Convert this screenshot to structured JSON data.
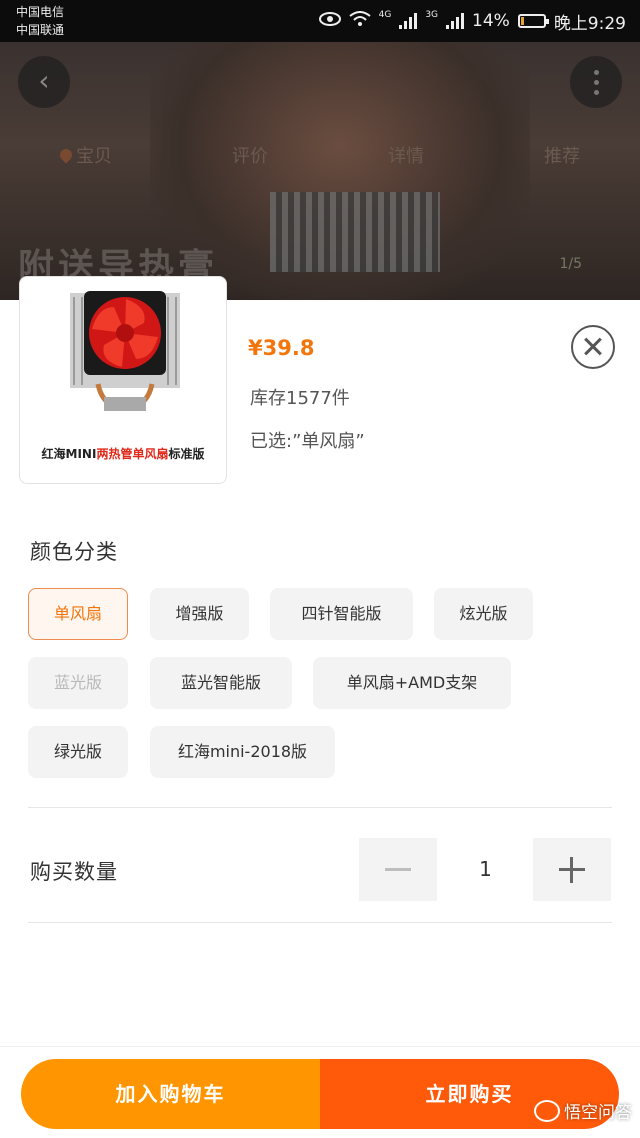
{
  "status_bar": {
    "carrier_1": "中国电信",
    "carrier_2": "中国联通",
    "net_1": "4G",
    "net_2": "3G",
    "battery": "14%",
    "battery_level": 0.14,
    "time": "晚上9:29"
  },
  "header": {
    "tabs": [
      "宝贝",
      "评价",
      "详情",
      "推荐"
    ],
    "banner_text": "附送导热膏",
    "image_counter": "1/5"
  },
  "product": {
    "thumbnail_caption_pre": "红海MINI",
    "thumbnail_caption_hl": "两热管单风扇",
    "thumbnail_caption_post": "标准版",
    "price": "¥39.8",
    "stock": "库存1577件",
    "selected": "已选:”单风扇”"
  },
  "variants": {
    "title": "颜色分类",
    "options": [
      {
        "label": "单风扇",
        "state": "selected"
      },
      {
        "label": "增强版",
        "state": "normal"
      },
      {
        "label": "四针智能版",
        "state": "normal"
      },
      {
        "label": "炫光版",
        "state": "normal"
      },
      {
        "label": "蓝光版",
        "state": "disabled"
      },
      {
        "label": "蓝光智能版",
        "state": "normal"
      },
      {
        "label": "单风扇+AMD支架",
        "state": "normal"
      },
      {
        "label": "绿光版",
        "state": "normal"
      },
      {
        "label": "红海mini-2018版",
        "state": "normal"
      }
    ]
  },
  "quantity": {
    "label": "购买数量",
    "value": "1"
  },
  "actions": {
    "add_to_cart": "加入购物车",
    "buy_now": "立即购买"
  },
  "watermark": "悟空问答",
  "colors": {
    "accent": "#f2760c",
    "cart_button": "#ff9500",
    "buy_button": "#ff5a0a",
    "thumb_highlight": "#e0291b"
  }
}
